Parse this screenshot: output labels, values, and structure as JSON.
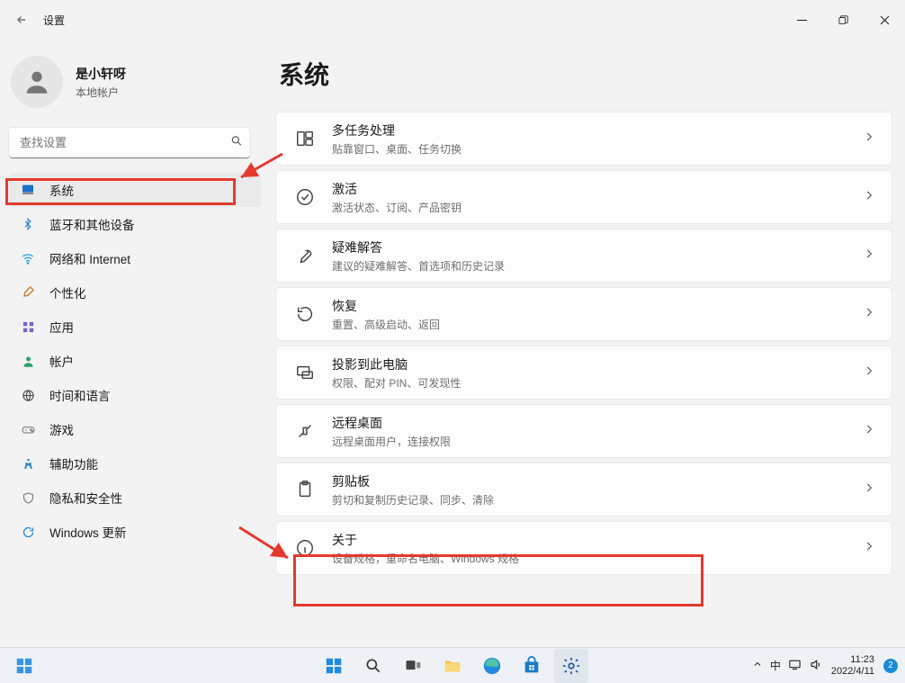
{
  "window": {
    "title": "设置"
  },
  "profile": {
    "name": "是小轩呀",
    "account_type": "本地帐户"
  },
  "search": {
    "placeholder": "查找设置"
  },
  "nav": {
    "items": [
      {
        "label": "系统"
      },
      {
        "label": "蓝牙和其他设备"
      },
      {
        "label": "网络和 Internet"
      },
      {
        "label": "个性化"
      },
      {
        "label": "应用"
      },
      {
        "label": "帐户"
      },
      {
        "label": "时间和语言"
      },
      {
        "label": "游戏"
      },
      {
        "label": "辅助功能"
      },
      {
        "label": "隐私和安全性"
      },
      {
        "label": "Windows 更新"
      }
    ]
  },
  "page": {
    "title": "系统"
  },
  "cards": [
    {
      "title": "多任务处理",
      "sub": "贴靠窗口、桌面、任务切换"
    },
    {
      "title": "激活",
      "sub": "激活状态、订阅、产品密钥"
    },
    {
      "title": "疑难解答",
      "sub": "建议的疑难解答、首选项和历史记录"
    },
    {
      "title": "恢复",
      "sub": "重置、高级启动、返回"
    },
    {
      "title": "投影到此电脑",
      "sub": "权限、配对 PIN、可发现性"
    },
    {
      "title": "远程桌面",
      "sub": "远程桌面用户，连接权限"
    },
    {
      "title": "剪贴板",
      "sub": "剪切和复制历史记录、同步、清除"
    },
    {
      "title": "关于",
      "sub": "设备规格，重命名电脑、Windows 规格"
    }
  ],
  "taskbar": {
    "ime": "中",
    "time": "11:23",
    "date": "2022/4/11",
    "notif_count": "2"
  }
}
